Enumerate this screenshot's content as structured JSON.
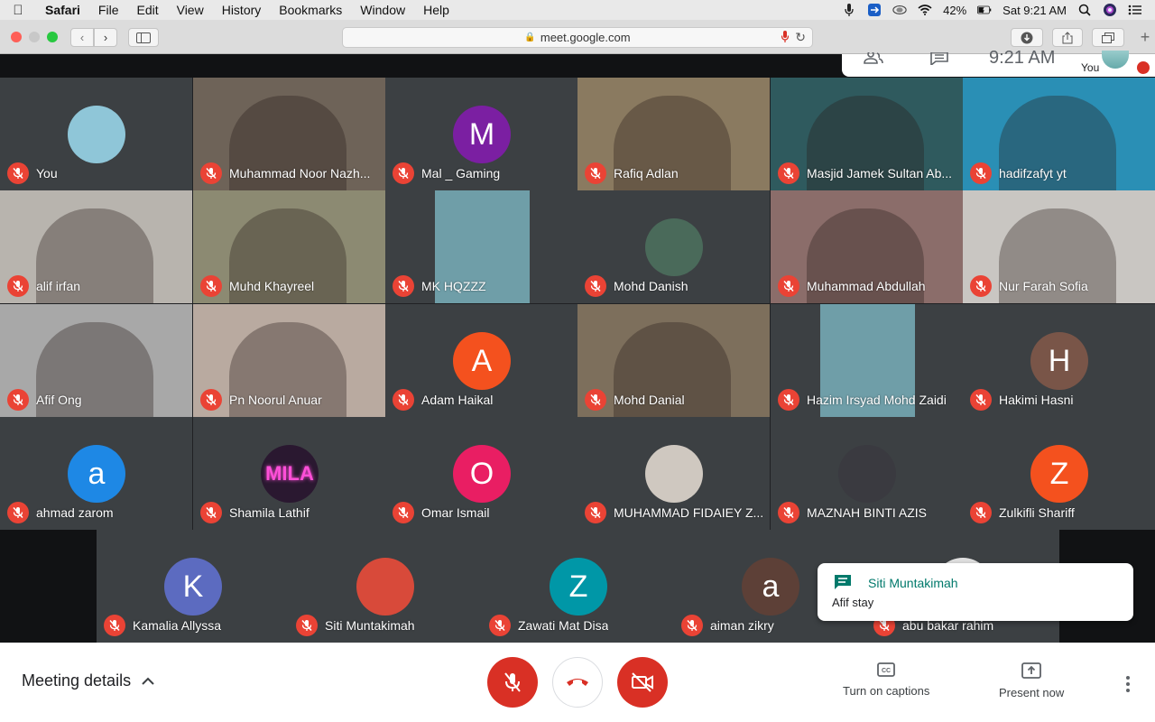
{
  "menubar": {
    "items": [
      "Safari",
      "File",
      "Edit",
      "View",
      "History",
      "Bookmarks",
      "Window",
      "Help"
    ],
    "battery": "42%",
    "clock": "Sat 9:21 AM"
  },
  "browser": {
    "url": "meet.google.com"
  },
  "self_panel": {
    "time": "9:21 AM",
    "you_label": "You"
  },
  "participants": [
    {
      "name": "You",
      "initial": "",
      "bg": "#3c4043",
      "kind": "photo-avatar",
      "avatar_color": "#8fc6d8"
    },
    {
      "name": "Muhammad Noor Nazh...",
      "initial": "",
      "bg": "#6e6358",
      "kind": "video"
    },
    {
      "name": "Mal _ Gaming",
      "initial": "M",
      "bg": "#3c4043",
      "kind": "letter",
      "avatar_color": "#7b1fa2"
    },
    {
      "name": "Rafiq Adlan",
      "initial": "",
      "bg": "#8a7a60",
      "kind": "video"
    },
    {
      "name": "Masjid Jamek Sultan Ab...",
      "initial": "",
      "bg": "#2f5a5e",
      "kind": "video"
    },
    {
      "name": "hadifzafyt yt",
      "initial": "",
      "bg": "#2a8fb5",
      "kind": "video"
    },
    {
      "name": "alif irfan",
      "initial": "",
      "bg": "#b8b4ae",
      "kind": "video"
    },
    {
      "name": "Muhd Khayreel",
      "initial": "",
      "bg": "#8c8a72",
      "kind": "video"
    },
    {
      "name": "MK HQZZZ",
      "initial": "",
      "bg": "#3c4043",
      "kind": "video-narrow"
    },
    {
      "name": "Mohd Danish",
      "initial": "",
      "bg": "#3c4043",
      "kind": "photo-avatar",
      "avatar_color": "#4a6a5a"
    },
    {
      "name": "Muhammad Abdullah",
      "initial": "",
      "bg": "#8b6d6a",
      "kind": "video"
    },
    {
      "name": "Nur Farah Sofia",
      "initial": "",
      "bg": "#c9c6c2",
      "kind": "video"
    },
    {
      "name": "Afif Ong",
      "initial": "",
      "bg": "#a8a8a8",
      "kind": "video"
    },
    {
      "name": "Pn Noorul Anuar",
      "initial": "",
      "bg": "#b9aaa0",
      "kind": "video"
    },
    {
      "name": "Adam Haikal",
      "initial": "A",
      "bg": "#3c4043",
      "kind": "letter",
      "avatar_color": "#f4511e"
    },
    {
      "name": "Mohd Danial",
      "initial": "",
      "bg": "#7d6f5c",
      "kind": "video"
    },
    {
      "name": "Hazim Irsyad Mohd Zaidi",
      "initial": "",
      "bg": "#3c4043",
      "kind": "video-narrow"
    },
    {
      "name": "Hakimi Hasni",
      "initial": "H",
      "bg": "#3c4043",
      "kind": "letter",
      "avatar_color": "#795548"
    },
    {
      "name": "ahmad zarom",
      "initial": "a",
      "bg": "#3c4043",
      "kind": "letter",
      "avatar_color": "#1e88e5"
    },
    {
      "name": "Shamila Lathif",
      "initial": "MILA",
      "bg": "#3c4043",
      "kind": "neon",
      "avatar_color": "#2a1830"
    },
    {
      "name": "Omar Ismail",
      "initial": "O",
      "bg": "#3c4043",
      "kind": "letter",
      "avatar_color": "#e91e63"
    },
    {
      "name": "MUHAMMAD FIDAIEY Z...",
      "initial": "",
      "bg": "#3c4043",
      "kind": "photo-avatar",
      "avatar_color": "#cfc8c0"
    },
    {
      "name": "MAZNAH BINTI AZIS",
      "initial": "",
      "bg": "#3c4043",
      "kind": "photo-avatar",
      "avatar_color": "#3a3a40"
    },
    {
      "name": "Zulkifli Shariff",
      "initial": "Z",
      "bg": "#3c4043",
      "kind": "letter",
      "avatar_color": "#f4511e"
    },
    {
      "name": "Kamalia Allyssa",
      "initial": "K",
      "bg": "#3c4043",
      "kind": "letter",
      "avatar_color": "#5c6bc0"
    },
    {
      "name": "Siti Muntakimah",
      "initial": "",
      "bg": "#3c4043",
      "kind": "photo-avatar",
      "avatar_color": "#d84a3a"
    },
    {
      "name": "Zawati Mat Disa",
      "initial": "Z",
      "bg": "#3c4043",
      "kind": "letter",
      "avatar_color": "#0097a7"
    },
    {
      "name": "aiman zikry",
      "initial": "a",
      "bg": "#3c4043",
      "kind": "letter",
      "avatar_color": "#5d4037"
    },
    {
      "name": "abu bakar rahim",
      "initial": "",
      "bg": "#3c4043",
      "kind": "photo-avatar",
      "avatar_color": "#e0e0e0"
    }
  ],
  "toast": {
    "sender": "Siti Muntakimah",
    "message": "Afif stay"
  },
  "bottom_bar": {
    "meeting_details": "Meeting details",
    "captions_label": "Turn on captions",
    "present_label": "Present now"
  },
  "colors": {
    "mute_red": "#ea4335",
    "control_red": "#d93025",
    "chat_green": "#00796b"
  }
}
